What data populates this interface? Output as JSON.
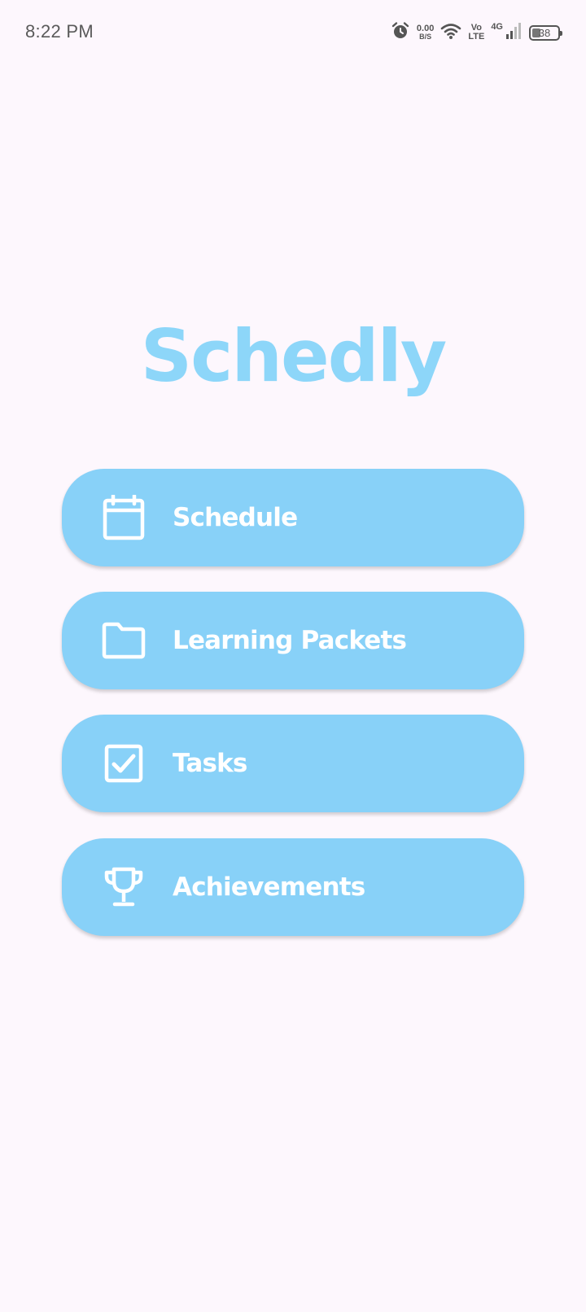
{
  "status_bar": {
    "time": "8:22 PM",
    "net_speed_value": "0.00",
    "net_speed_unit": "B/S",
    "volte_top": "Vo",
    "volte_bottom": "LTE",
    "network": "4G",
    "battery": "38",
    "icons": [
      "alarm-icon",
      "wifi-icon",
      "signal-icon",
      "battery-icon"
    ]
  },
  "app": {
    "title": "Schedly",
    "accent_color": "#88d1f8",
    "background_color": "#fdf7fd"
  },
  "menu": {
    "items": [
      {
        "label": "Schedule",
        "icon": "calendar-icon"
      },
      {
        "label": "Learning Packets",
        "icon": "folder-icon"
      },
      {
        "label": "Tasks",
        "icon": "checkbox-icon"
      },
      {
        "label": "Achievements",
        "icon": "trophy-icon"
      }
    ]
  }
}
